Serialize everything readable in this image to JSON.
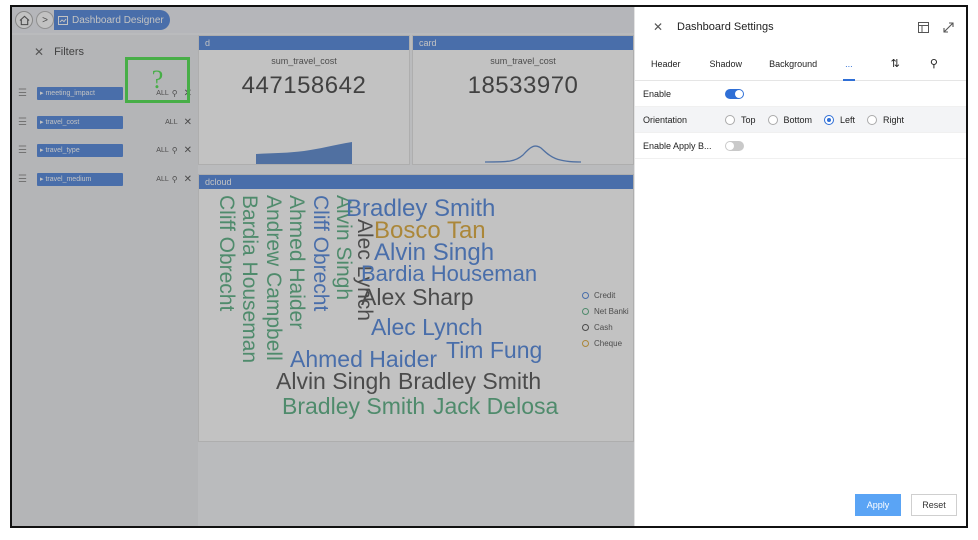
{
  "breadcrumb": {
    "home_icon": "home-icon",
    "arrow": ">",
    "current": "Dashboard Designer"
  },
  "cards": [
    {
      "title": "d",
      "label": "sum_travel_cost",
      "value": "447158642"
    },
    {
      "title": "card",
      "label": "sum_travel_cost",
      "value": "18533970"
    }
  ],
  "wordcloud": {
    "title": "dcloud",
    "colors": {
      "green": "#3aa06c",
      "blue": "#2f6fd6",
      "dark": "#333333",
      "orange": "#d89a14"
    },
    "words_vertical": [
      "Cliff Obrecht",
      "Bardia Houseman",
      "Andrew Campbell",
      "Ahmed Haider",
      "Cliff Obrecht",
      "Alvin Singh",
      "Alec Lynch"
    ],
    "words_horizontal": [
      "Bradley Smith",
      "Bosco Tan",
      "Alvin Singh",
      "Bardia Houseman",
      "Alex Sharp",
      "Alec Lynch",
      "Ahmed Haider",
      "Tim Fung",
      "Alvin Singh",
      "Bradley Smith",
      "Bradley Smith",
      "Jack Delosa"
    ],
    "legend": [
      "Credit",
      "Net Banki",
      "Cash",
      "Cheque"
    ]
  },
  "filters": {
    "title": "Filters",
    "items": [
      {
        "name": "meeting_impact",
        "value": "ALL"
      },
      {
        "name": "travel_cost",
        "value": "ALL"
      },
      {
        "name": "travel_type",
        "value": "ALL"
      },
      {
        "name": "travel_medium",
        "value": "ALL"
      }
    ]
  },
  "help_glyph": "?",
  "settings": {
    "title": "Dashboard Settings",
    "tabs": [
      "Header",
      "Shadow",
      "Background",
      "..."
    ],
    "rows": {
      "enable": "Enable",
      "orientation": "Orientation",
      "enable_apply": "Enable Apply B..."
    },
    "orientation_options": [
      "Top",
      "Bottom",
      "Left",
      "Right"
    ],
    "selected_orientation": "Left",
    "apply": "Apply",
    "reset": "Reset",
    "accent": "#2f6fd6"
  }
}
